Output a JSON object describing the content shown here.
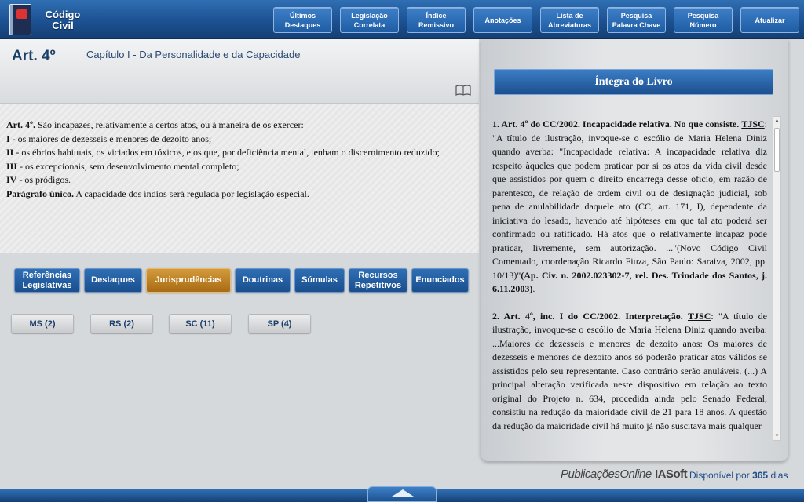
{
  "app": {
    "title_line1": "Código",
    "title_line2": "Civil"
  },
  "topnav": [
    {
      "label": "Últimos\nDestaques"
    },
    {
      "label": "Legislação\nCorrelata"
    },
    {
      "label": "Índice\nRemissivo"
    },
    {
      "label": "Anotações"
    },
    {
      "label": "Lista de\nAbreviaturas"
    },
    {
      "label": "Pesquisa\nPalavra Chave"
    },
    {
      "label": "Pesquisa\nNúmero"
    },
    {
      "label": "Atualizar"
    }
  ],
  "article": {
    "title": "Art. 4º",
    "chapter": "Capítulo I - Da Personalidade e da Capacidade",
    "lines": [
      {
        "lead": "Art. 4º.",
        "text": " São incapazes, relativamente a certos atos, ou à maneira de os exercer:"
      },
      {
        "lead": "I",
        "text": " - os maiores de dezesseis e menores de dezoito anos;"
      },
      {
        "lead": "II",
        "text": " - os ébrios habituais, os viciados em tóxicos, e os que, por deficiência mental, tenham o discernimento reduzido;"
      },
      {
        "lead": "III",
        "text": " - os excepcionais, sem desenvolvimento mental completo;"
      },
      {
        "lead": "IV",
        "text": " - os pródigos."
      },
      {
        "lead": "Parágrafo único.",
        "text": " A capacidade dos índios será regulada por legislação especial."
      }
    ]
  },
  "category_tabs": [
    {
      "label": "Referências\nLegislativas"
    },
    {
      "label": "Destaques"
    },
    {
      "label": "Jurisprudências",
      "active": true
    },
    {
      "label": "Doutrinas"
    },
    {
      "label": "Súmulas"
    },
    {
      "label": "Recursos\nRepetitivos"
    },
    {
      "label": "Enunciados"
    }
  ],
  "court_filters": [
    {
      "label": "MS (2)"
    },
    {
      "label": "RS (2)"
    },
    {
      "label": "SC (11)"
    },
    {
      "label": "SP (4)"
    }
  ],
  "panel": {
    "header": "Íntegra do Livro",
    "entries": [
      {
        "heading": "1. Art. 4º do CC/2002. Incapacidade relativa. No que consiste.",
        "court": "TJSC",
        "body": ": \"A título de ilustração, invoque-se o escólio de Maria Helena Diniz quando averba: \"Incapacidade relativa: A incapacidade relativa diz respeito àqueles que podem praticar por si os atos da vida civil desde que assistidos por quem o direito encarrega desse ofício, em razão de parentesco, de relação de ordem civil ou de designação judicial, sob pena de anulabilidade daquele ato (CC, art. 171, I), dependente da iniciativa do lesado, havendo até hipóteses em que tal ato poderá ser confirmado ou ratificado. Há atos que o relativamente incapaz pode praticar, livremente, sem autorização. ...\"(Novo Código Civil Comentado, coordenação Ricardo Fiuza, São Paulo: Saraiva, 2002, pp. 10/13)\"",
        "citation": "(Ap. Civ. n. 2002.023302-7, rel. Des. Trindade dos Santos, j. 6.11.2003)",
        "tail": "."
      },
      {
        "heading": "2. Art. 4º, inc. I do CC/2002. Interpretação.",
        "court": "TJSC",
        "body": ": \"A título de ilustração, invoque-se o escólio de Maria Helena Diniz quando averba: ...Maiores de dezesseis e menores de dezoito anos: Os maiores de dezesseis e menores de dezoito anos só poderão praticar atos válidos se assistidos pelo seu representante. Caso contrário serão anuláveis. (...) A principal alteração verificada neste dispositivo em relação ao texto original do Projeto n. 634, procedida ainda pelo Senado Federal, consistiu na redução da maioridade civil de 21 para 18 anos. A questão da redução da maioridade civil há muito já não suscitava mais qualquer",
        "citation": "",
        "tail": ""
      }
    ]
  },
  "footer": {
    "brand1": "PublicaçõesOnline",
    "brand2": "IASoft",
    "available_prefix": "Disponível por",
    "available_days": "365",
    "available_suffix": "dias"
  }
}
